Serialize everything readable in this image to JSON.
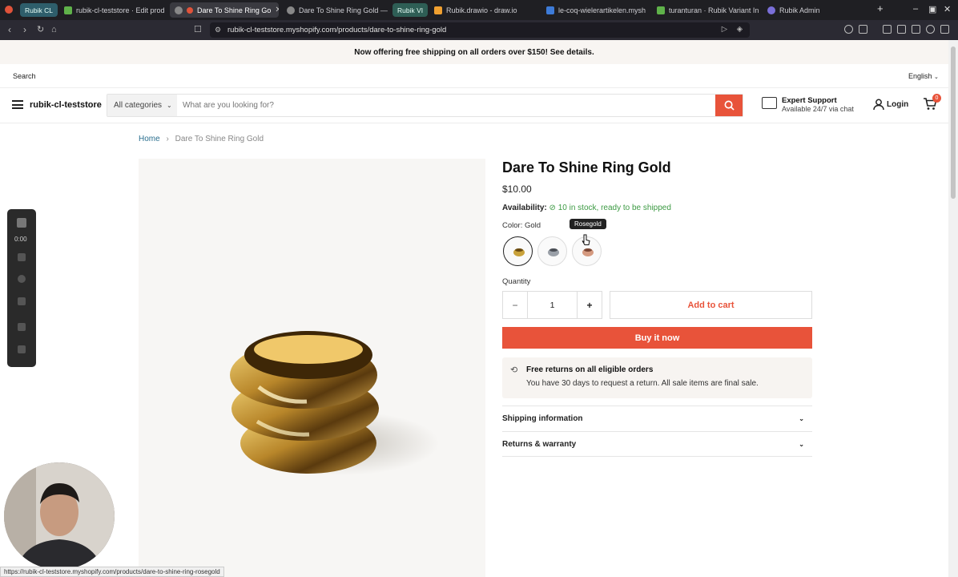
{
  "browser": {
    "tabs": [
      {
        "label": "rubik-cl-teststore · Edit prod",
        "icon_color": "#5fb24a"
      },
      {
        "label": "Dare To Shine Ring Go",
        "icon_color": "#e0533a",
        "active": true
      },
      {
        "label": "Dare To Shine Ring Gold —",
        "icon_color": "#888888"
      },
      {
        "label": "Rubik.drawio - draw.io",
        "icon_color": "#f0a030"
      },
      {
        "label": "le-coq-wielerartikelen.mysh",
        "icon_color": "#3d7bd8"
      },
      {
        "label": "turanturan · Rubik Variant In",
        "icon_color": "#5fb24a"
      },
      {
        "label": "Rubik Admin",
        "icon_color": "#7a6fd8"
      }
    ],
    "groups": [
      "Rubik CL",
      "Rubik VI"
    ],
    "url": "rubik-cl-teststore.myshopify.com/products/dare-to-shine-ring-gold",
    "status_url": "https://rubik-cl-teststore.myshopify.com/products/dare-to-shine-ring-rosegold"
  },
  "announcement": "Now offering free shipping on all orders over $150! See details.",
  "topbar": {
    "search_link": "Search",
    "language": "English"
  },
  "header": {
    "store_name": "rubik-cl-teststore",
    "category_select": "All categories",
    "search_placeholder": "What are you looking for?",
    "support_title": "Expert Support",
    "support_sub": "Available 24/7 via chat",
    "login": "Login",
    "cart_count": "0"
  },
  "breadcrumb": {
    "home": "Home",
    "current": "Dare To Shine Ring Gold"
  },
  "recorder": {
    "time": "0:00"
  },
  "product": {
    "title": "Dare To Shine Ring Gold",
    "price": "$10.00",
    "availability_label": "Availability:",
    "availability_value": "10 in stock, ready to be shipped",
    "color_label": "Color: Gold",
    "tooltip": "Rosegold",
    "quantity_label": "Quantity",
    "quantity": "1",
    "add_to_cart": "Add to cart",
    "buy_now": "Buy it now",
    "returns_title": "Free returns on all eligible orders",
    "returns_text": "You have 30 days to request a return. All sale items are final sale.",
    "accordions": [
      "Shipping information",
      "Returns & warranty"
    ]
  },
  "colors": {
    "accent": "#e8533a",
    "in_stock": "#3c9a43",
    "gold": "#c9a23a"
  }
}
